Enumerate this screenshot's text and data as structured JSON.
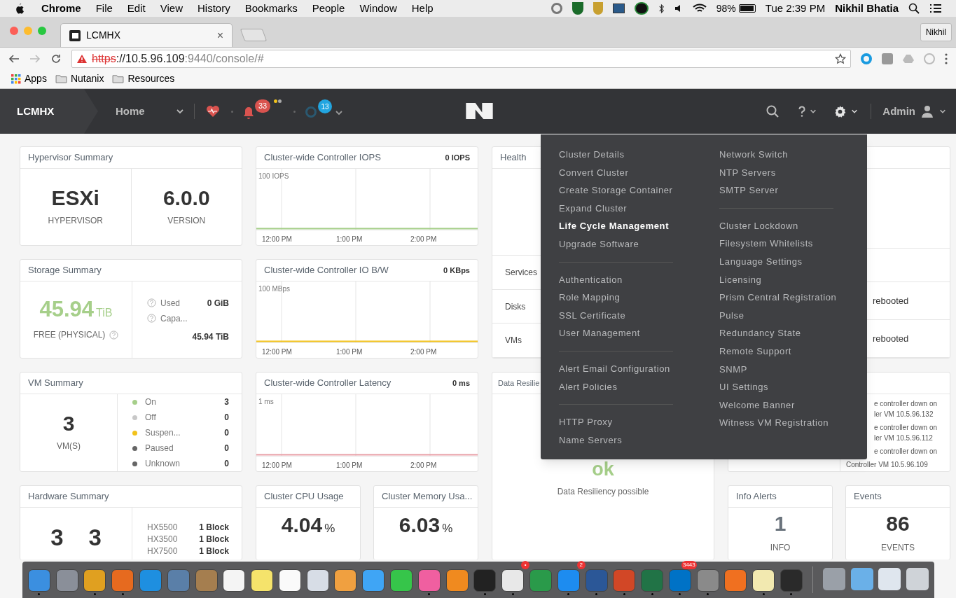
{
  "menu_bar": {
    "app": "Chrome",
    "items": [
      "File",
      "Edit",
      "View",
      "History",
      "Bookmarks",
      "People",
      "Window",
      "Help"
    ],
    "battery": "98%",
    "clock": "Tue 2:39 PM",
    "user": "Nikhil Bhatia"
  },
  "browser": {
    "tab": {
      "title": "LCMHX",
      "close": "×"
    },
    "profile": "Nikhil",
    "url": {
      "scheme": "https",
      "host": "://10.5.96.109",
      "rest": ":9440/console/#"
    },
    "bookmarks": [
      {
        "kind": "apps",
        "label": "Apps"
      },
      {
        "kind": "folder",
        "label": "Nutanix"
      },
      {
        "kind": "folder",
        "label": "Resources"
      }
    ]
  },
  "app_header": {
    "cluster": "LCMHX",
    "view": "Home",
    "alert_count": "33",
    "task_count": "13",
    "user": "Admin"
  },
  "cards": {
    "hypervisor": {
      "title": "Hypervisor Summary",
      "name": "ESXi",
      "name_label": "HYPERVISOR",
      "version": "6.0.0",
      "version_label": "VERSION"
    },
    "storage": {
      "title": "Storage Summary",
      "free": "45.94",
      "free_unit": "TiB",
      "free_label": "FREE (PHYSICAL)",
      "rows": [
        {
          "label": "Used",
          "value": "0 GiB"
        },
        {
          "label": "Capa...",
          "value": "45.94 TiB"
        }
      ]
    },
    "vm": {
      "title": "VM Summary",
      "count": "3",
      "count_label": "VM(S)",
      "states": [
        {
          "label": "On",
          "value": "3",
          "color": "#a6cf8a"
        },
        {
          "label": "Off",
          "value": "0",
          "color": "#c8c8c8"
        },
        {
          "label": "Suspen...",
          "value": "0",
          "color": "#f2c21b"
        },
        {
          "label": "Paused",
          "value": "0",
          "color": "#666666"
        },
        {
          "label": "Unknown",
          "value": "0",
          "color": "#666666"
        }
      ]
    },
    "hardware": {
      "title": "Hardware Summary",
      "hosts": "3",
      "blocks": "3",
      "models": [
        {
          "model": "HX5500",
          "value": "1 Block"
        },
        {
          "model": "HX3500",
          "value": "1 Block"
        },
        {
          "model": "HX7500",
          "value": "1 Block"
        }
      ]
    },
    "charts": [
      {
        "title": "Cluster-wide Controller IOPS",
        "reading": "0 IOPS",
        "scale": "100 IOPS",
        "color": "#a6cf8a",
        "times": [
          "12:00 PM",
          "1:00 PM",
          "2:00 PM"
        ]
      },
      {
        "title": "Cluster-wide Controller IO B/W",
        "reading": "0 KBps",
        "scale": "100 MBps",
        "color": "#f2c21b",
        "times": [
          "12:00 PM",
          "1:00 PM",
          "2:00 PM"
        ]
      },
      {
        "title": "Cluster-wide Controller Latency",
        "reading": "0 ms",
        "scale": "1 ms",
        "color": "#e8a0a8",
        "times": [
          "12:00 PM",
          "1:00 PM",
          "2:00 PM"
        ]
      }
    ],
    "cpu": {
      "title": "Cluster CPU Usage",
      "value": "4.04",
      "unit": "%"
    },
    "memory": {
      "title": "Cluster Memory Usa...",
      "value": "6.03",
      "unit": "%"
    },
    "health": {
      "title": "Health",
      "rows": [
        "Services",
        "Disks",
        "VMs"
      ]
    },
    "critical": {
      "rows": [
        "rebooted",
        "rebooted"
      ]
    },
    "resiliency": {
      "title": "Data Resilie",
      "status": "ok",
      "caption": "Data Resiliency possible"
    },
    "warnings": {
      "lines": [
        "e controller down on",
        "ler VM 10.5.96.132",
        "e controller down on",
        "ler VM 10.5.96.112",
        "e controller down on"
      ],
      "last": "Controller VM 10.5.96.109"
    },
    "info": {
      "title": "Info Alerts",
      "value": "1",
      "label": "INFO"
    },
    "events": {
      "title": "Events",
      "value": "86",
      "label": "EVENTS"
    }
  },
  "settings_menu": {
    "columns": [
      [
        [
          {
            "label": "Cluster Details",
            "selected": false
          },
          {
            "label": "Convert Cluster",
            "selected": false
          },
          {
            "label": "Create Storage Container",
            "selected": false
          },
          {
            "label": "Expand Cluster",
            "selected": false
          },
          {
            "label": "Life Cycle Management",
            "selected": true
          },
          {
            "label": "Upgrade Software",
            "selected": false
          }
        ],
        [
          {
            "label": "Authentication",
            "selected": false
          },
          {
            "label": "Role Mapping",
            "selected": false
          },
          {
            "label": "SSL Certificate",
            "selected": false
          },
          {
            "label": "User Management",
            "selected": false
          }
        ],
        [
          {
            "label": "Alert Email Configuration",
            "selected": false
          },
          {
            "label": "Alert Policies",
            "selected": false
          }
        ],
        [
          {
            "label": "HTTP Proxy",
            "selected": false
          },
          {
            "label": "Name Servers",
            "selected": false
          }
        ]
      ],
      [
        [
          {
            "label": "Network Switch",
            "selected": false
          },
          {
            "label": "NTP Servers",
            "selected": false
          },
          {
            "label": "SMTP Server",
            "selected": false
          }
        ],
        [
          {
            "label": "Cluster Lockdown",
            "selected": false
          },
          {
            "label": "Filesystem Whitelists",
            "selected": false
          },
          {
            "label": "Language Settings",
            "selected": false
          },
          {
            "label": "Licensing",
            "selected": false
          },
          {
            "label": "Prism Central Registration",
            "selected": false
          },
          {
            "label": "Pulse",
            "selected": false
          },
          {
            "label": "Redundancy State",
            "selected": false
          },
          {
            "label": "Remote Support",
            "selected": false
          },
          {
            "label": "SNMP",
            "selected": false
          },
          {
            "label": "UI Settings",
            "selected": false
          },
          {
            "label": "Welcome Banner",
            "selected": false
          },
          {
            "label": "Witness VM Registration",
            "selected": false
          }
        ]
      ]
    ]
  },
  "dock": [
    {
      "color": "#3b8fe0",
      "running": true
    },
    {
      "color": "#8a8f99",
      "running": false
    },
    {
      "color": "#e0a020",
      "running": true
    },
    {
      "color": "#e66a1f",
      "running": true
    },
    {
      "color": "#1e8fe0",
      "running": false
    },
    {
      "color": "#5a7fa8",
      "running": false
    },
    {
      "color": "#a57e4f",
      "running": false
    },
    {
      "color": "#f4f4f4",
      "running": false
    },
    {
      "color": "#f5e36b",
      "running": false
    },
    {
      "color": "#fafafa",
      "running": false
    },
    {
      "color": "#d7dde6",
      "running": false
    },
    {
      "color": "#f0a040",
      "running": false
    },
    {
      "color": "#3fa5f5",
      "running": false
    },
    {
      "color": "#36c54a",
      "running": false
    },
    {
      "color": "#f05fa0",
      "running": true
    },
    {
      "color": "#f08a1f",
      "running": false
    },
    {
      "color": "#222222",
      "running": true
    },
    {
      "color": "#e8e8e8",
      "running": true,
      "badge": "•"
    },
    {
      "color": "#2a9a4a",
      "running": false
    },
    {
      "color": "#1d8cf0",
      "running": true,
      "badge": "2"
    },
    {
      "color": "#2b5797",
      "running": true
    },
    {
      "color": "#d24726",
      "running": true
    },
    {
      "color": "#217346",
      "running": true
    },
    {
      "color": "#0072c6",
      "running": true,
      "badge": "3443"
    },
    {
      "color": "#8a8a8a",
      "running": true
    },
    {
      "color": "#f07020",
      "running": false
    },
    {
      "color": "#f2e9b0",
      "running": true
    },
    {
      "color": "#2a2a2a",
      "running": true
    }
  ],
  "dock_right": [
    {
      "color": "#9aa0a8"
    },
    {
      "color": "#6ab0e8"
    },
    {
      "color": "#dfe6ee"
    },
    {
      "color": "#cfd3d8"
    }
  ]
}
